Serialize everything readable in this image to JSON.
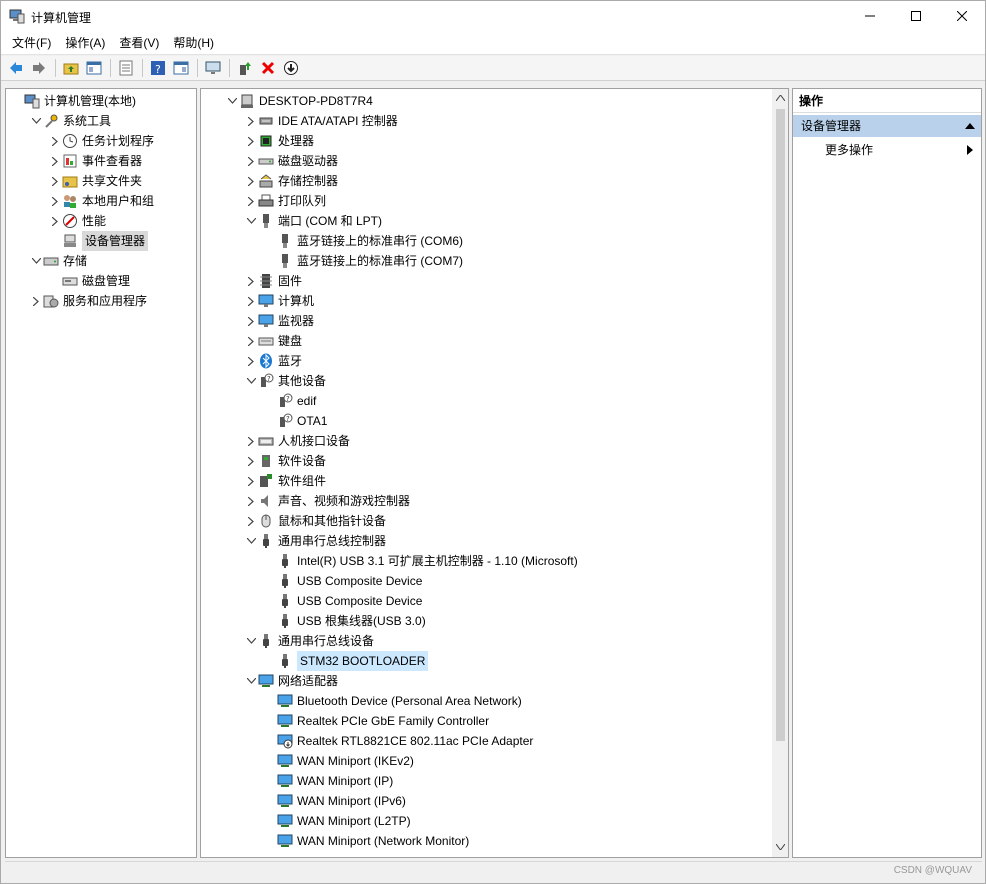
{
  "window": {
    "title": "计算机管理"
  },
  "menu": [
    "文件(F)",
    "操作(A)",
    "查看(V)",
    "帮助(H)"
  ],
  "left_tree": [
    {
      "label": "计算机管理(本地)",
      "icon": "computer-mgmt-icon",
      "level": 0,
      "chev": ""
    },
    {
      "label": "系统工具",
      "icon": "tools-icon",
      "level": 1,
      "chev": "open"
    },
    {
      "label": "任务计划程序",
      "icon": "clock-icon",
      "level": 2,
      "chev": "closed"
    },
    {
      "label": "事件查看器",
      "icon": "event-viewer-icon",
      "level": 2,
      "chev": "closed"
    },
    {
      "label": "共享文件夹",
      "icon": "shared-folder-icon",
      "level": 2,
      "chev": "closed"
    },
    {
      "label": "本地用户和组",
      "icon": "users-icon",
      "level": 2,
      "chev": "closed"
    },
    {
      "label": "性能",
      "icon": "performance-icon",
      "level": 2,
      "chev": "closed"
    },
    {
      "label": "设备管理器",
      "icon": "device-manager-icon",
      "level": 2,
      "chev": "",
      "selected": true
    },
    {
      "label": "存储",
      "icon": "storage-icon",
      "level": 1,
      "chev": "open"
    },
    {
      "label": "磁盘管理",
      "icon": "disk-mgmt-icon",
      "level": 2,
      "chev": ""
    },
    {
      "label": "服务和应用程序",
      "icon": "services-icon",
      "level": 1,
      "chev": "closed"
    }
  ],
  "device_tree": [
    {
      "label": "DESKTOP-PD8T7R4",
      "icon": "computer-icon",
      "level": 0,
      "chev": "open"
    },
    {
      "label": "IDE ATA/ATAPI 控制器",
      "icon": "ide-icon",
      "level": 1,
      "chev": "closed"
    },
    {
      "label": "处理器",
      "icon": "cpu-icon",
      "level": 1,
      "chev": "closed"
    },
    {
      "label": "磁盘驱动器",
      "icon": "disk-icon",
      "level": 1,
      "chev": "closed"
    },
    {
      "label": "存储控制器",
      "icon": "storage-controller-icon",
      "level": 1,
      "chev": "closed"
    },
    {
      "label": "打印队列",
      "icon": "printer-icon",
      "level": 1,
      "chev": "closed"
    },
    {
      "label": "端口 (COM 和 LPT)",
      "icon": "port-icon",
      "level": 1,
      "chev": "open"
    },
    {
      "label": "蓝牙链接上的标准串行 (COM6)",
      "icon": "port-icon",
      "level": 2,
      "chev": ""
    },
    {
      "label": "蓝牙链接上的标准串行 (COM7)",
      "icon": "port-icon",
      "level": 2,
      "chev": ""
    },
    {
      "label": "固件",
      "icon": "firmware-icon",
      "level": 1,
      "chev": "closed"
    },
    {
      "label": "计算机",
      "icon": "monitor-icon",
      "level": 1,
      "chev": "closed"
    },
    {
      "label": "监视器",
      "icon": "monitor-icon",
      "level": 1,
      "chev": "closed"
    },
    {
      "label": "键盘",
      "icon": "keyboard-icon",
      "level": 1,
      "chev": "closed"
    },
    {
      "label": "蓝牙",
      "icon": "bluetooth-icon",
      "level": 1,
      "chev": "closed"
    },
    {
      "label": "其他设备",
      "icon": "unknown-device-icon",
      "level": 1,
      "chev": "open"
    },
    {
      "label": "edif",
      "icon": "unknown-device-icon",
      "level": 2,
      "chev": ""
    },
    {
      "label": "OTA1",
      "icon": "unknown-device-icon",
      "level": 2,
      "chev": ""
    },
    {
      "label": "人机接口设备",
      "icon": "hid-icon",
      "level": 1,
      "chev": "closed"
    },
    {
      "label": "软件设备",
      "icon": "software-device-icon",
      "level": 1,
      "chev": "closed"
    },
    {
      "label": "软件组件",
      "icon": "software-component-icon",
      "level": 1,
      "chev": "closed"
    },
    {
      "label": "声音、视频和游戏控制器",
      "icon": "speaker-icon",
      "level": 1,
      "chev": "closed"
    },
    {
      "label": "鼠标和其他指针设备",
      "icon": "mouse-icon",
      "level": 1,
      "chev": "closed"
    },
    {
      "label": "通用串行总线控制器",
      "icon": "usb-icon",
      "level": 1,
      "chev": "open"
    },
    {
      "label": "Intel(R) USB 3.1 可扩展主机控制器 - 1.10 (Microsoft)",
      "icon": "usb-icon",
      "level": 2,
      "chev": ""
    },
    {
      "label": "USB Composite Device",
      "icon": "usb-icon",
      "level": 2,
      "chev": ""
    },
    {
      "label": "USB Composite Device",
      "icon": "usb-icon",
      "level": 2,
      "chev": ""
    },
    {
      "label": "USB 根集线器(USB 3.0)",
      "icon": "usb-icon",
      "level": 2,
      "chev": ""
    },
    {
      "label": "通用串行总线设备",
      "icon": "usb-icon",
      "level": 1,
      "chev": "open"
    },
    {
      "label": "STM32  BOOTLOADER",
      "icon": "usb-icon",
      "level": 2,
      "chev": "",
      "selected": true
    },
    {
      "label": "网络适配器",
      "icon": "network-icon",
      "level": 1,
      "chev": "open"
    },
    {
      "label": "Bluetooth Device (Personal Area Network)",
      "icon": "network-icon",
      "level": 2,
      "chev": ""
    },
    {
      "label": "Realtek PCIe GbE Family Controller",
      "icon": "network-icon",
      "level": 2,
      "chev": ""
    },
    {
      "label": "Realtek RTL8821CE 802.11ac PCIe Adapter",
      "icon": "network-disabled-icon",
      "level": 2,
      "chev": ""
    },
    {
      "label": "WAN Miniport (IKEv2)",
      "icon": "network-icon",
      "level": 2,
      "chev": ""
    },
    {
      "label": "WAN Miniport (IP)",
      "icon": "network-icon",
      "level": 2,
      "chev": ""
    },
    {
      "label": "WAN Miniport (IPv6)",
      "icon": "network-icon",
      "level": 2,
      "chev": ""
    },
    {
      "label": "WAN Miniport (L2TP)",
      "icon": "network-icon",
      "level": 2,
      "chev": ""
    },
    {
      "label": "WAN Miniport (Network Monitor)",
      "icon": "network-icon",
      "level": 2,
      "chev": ""
    }
  ],
  "actions": {
    "header": "操作",
    "section": "设备管理器",
    "more": "更多操作"
  },
  "status": {
    "watermark": "CSDN @WQUAV"
  },
  "colors": {
    "selection": "#cce8ff",
    "section": "#b9d1ea"
  }
}
